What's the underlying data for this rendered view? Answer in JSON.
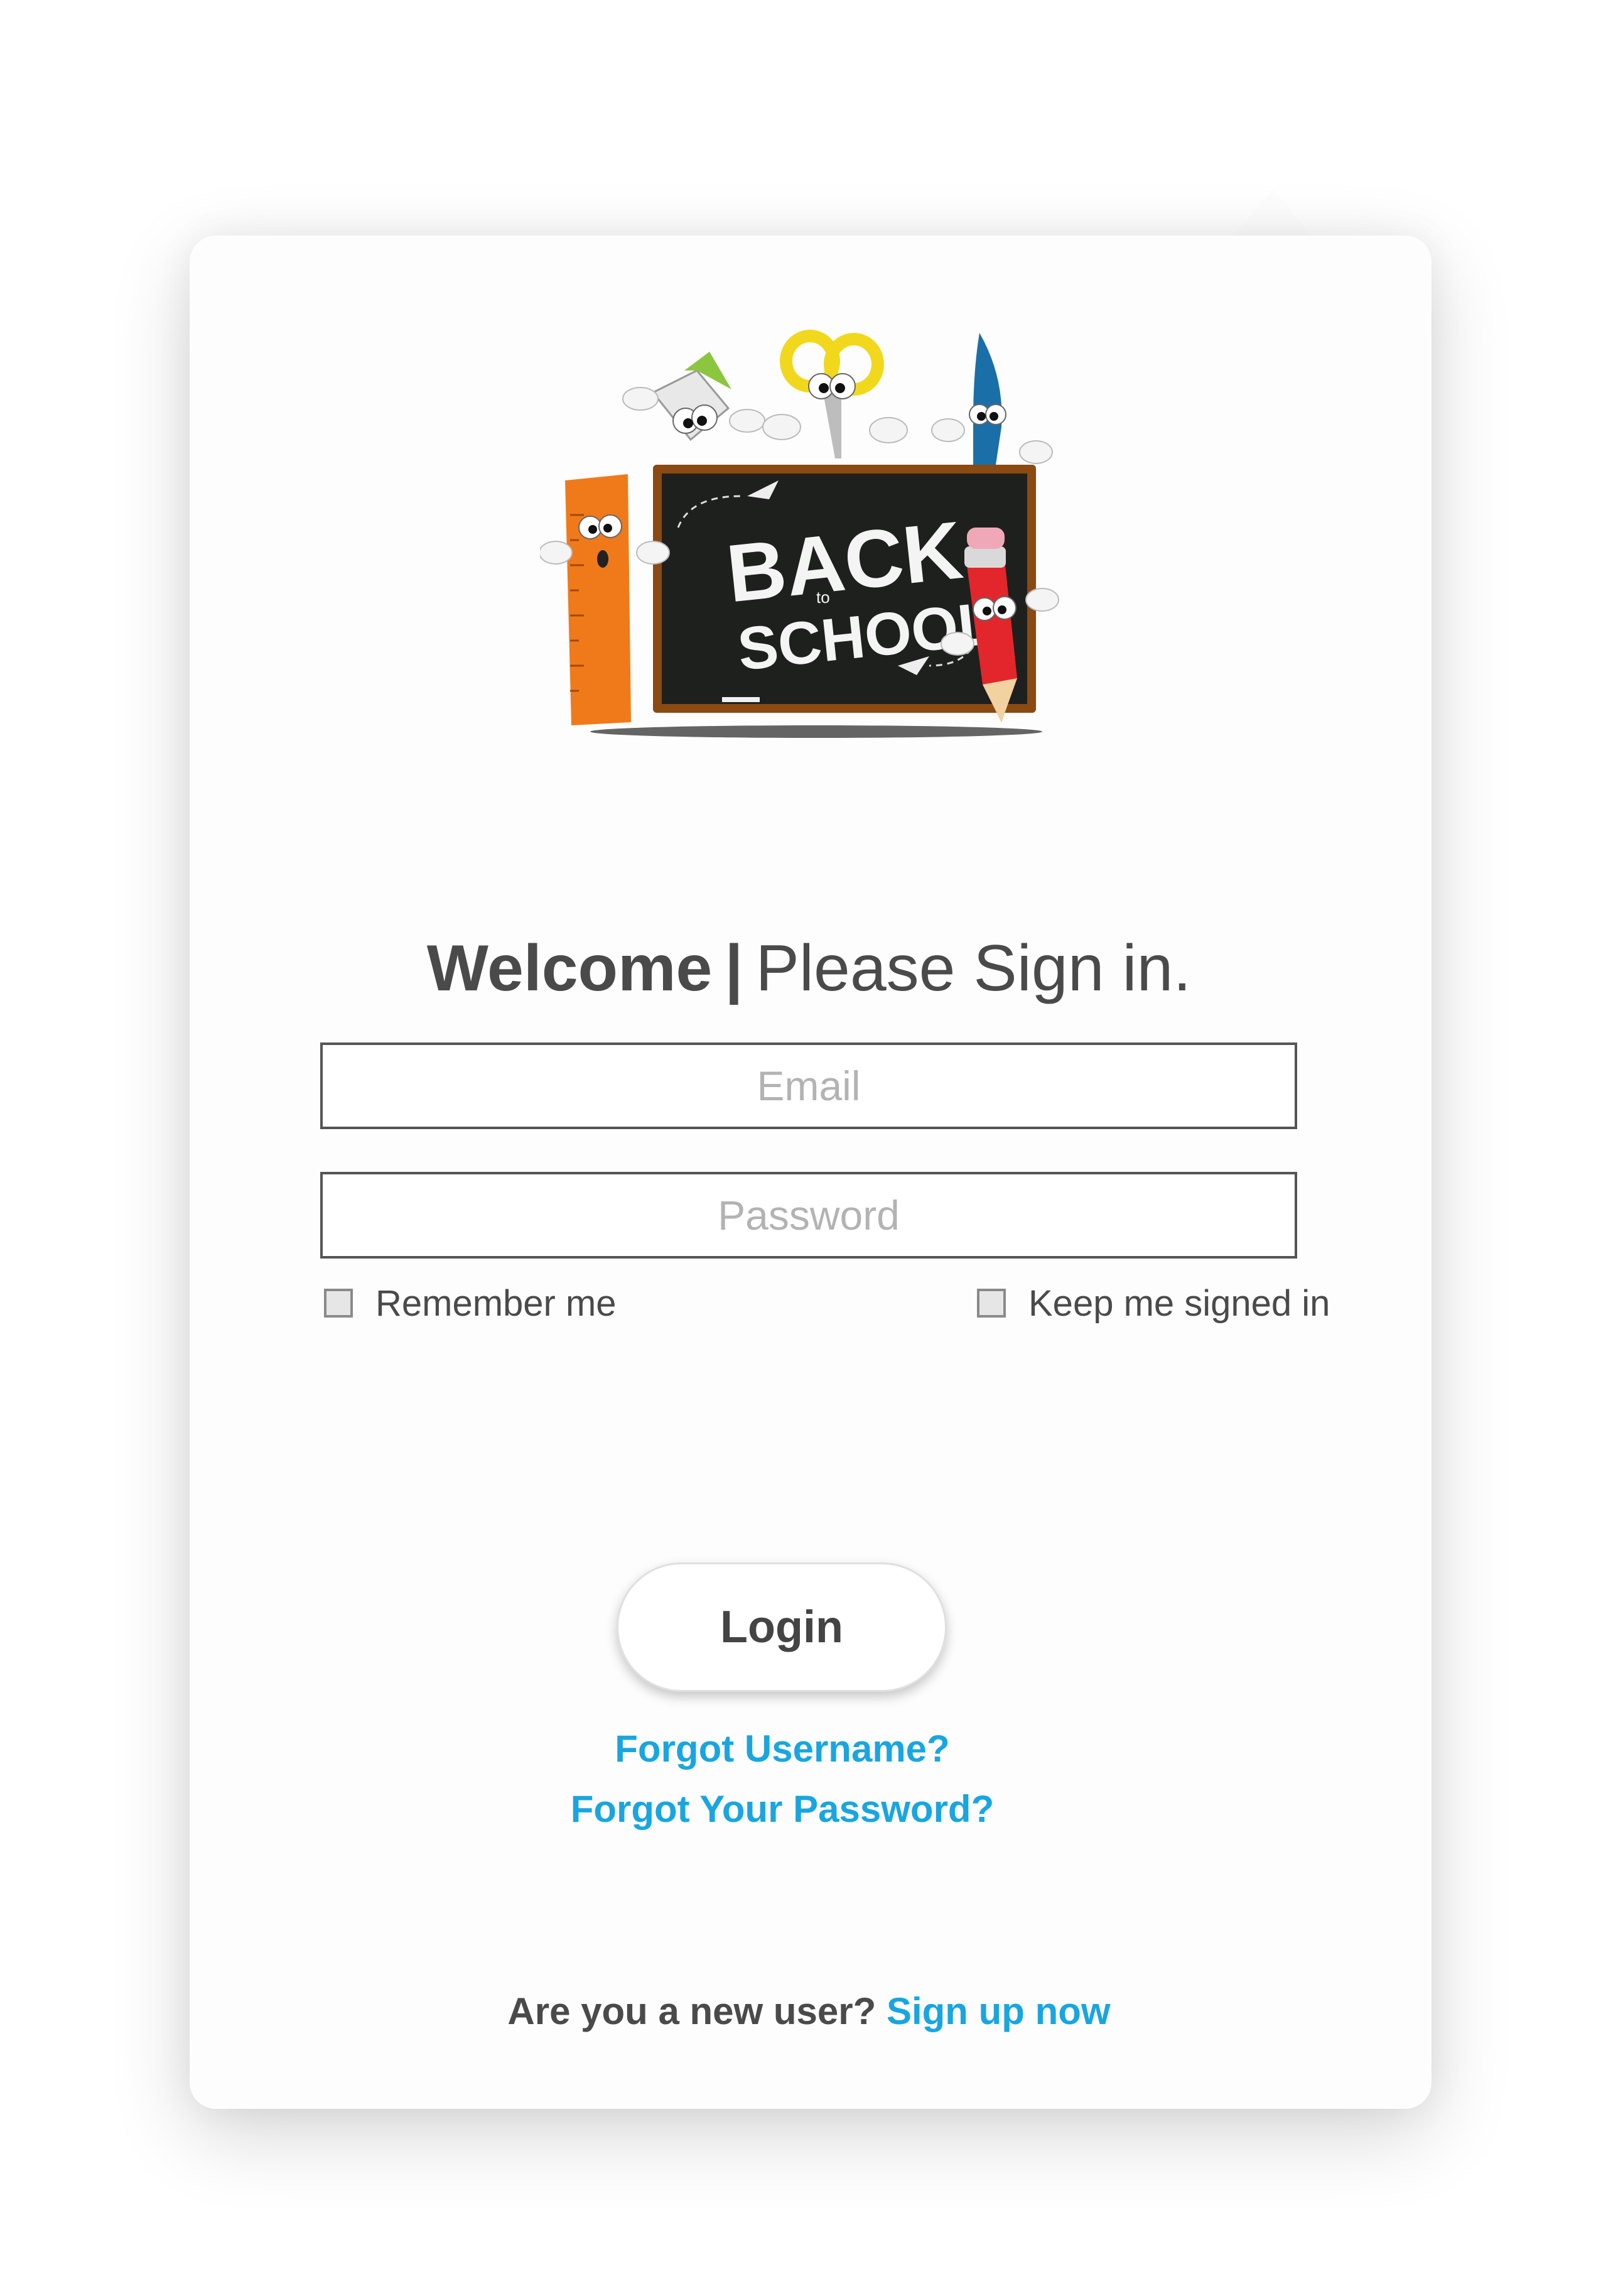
{
  "logo": {
    "line1": "BACK",
    "small": "to",
    "line2": "SCHOOL"
  },
  "heading": {
    "welcome": "Welcome",
    "separator": "|",
    "prompt": "Please Sign in."
  },
  "form": {
    "email_placeholder": "Email",
    "password_placeholder": "Password",
    "remember_label": "Remember me",
    "keep_signed_label": "Keep me signed in",
    "login_label": "Login"
  },
  "links": {
    "forgot_username": "Forgot Username?",
    "forgot_password": "Forgot Your Password?"
  },
  "signup": {
    "question": "Are you a new user?",
    "link": "Sign up now"
  },
  "colors": {
    "link": "#19a6e0",
    "text": "#4a4a4a",
    "chalkboard": "#1e201e",
    "frame": "#8a4a12"
  }
}
